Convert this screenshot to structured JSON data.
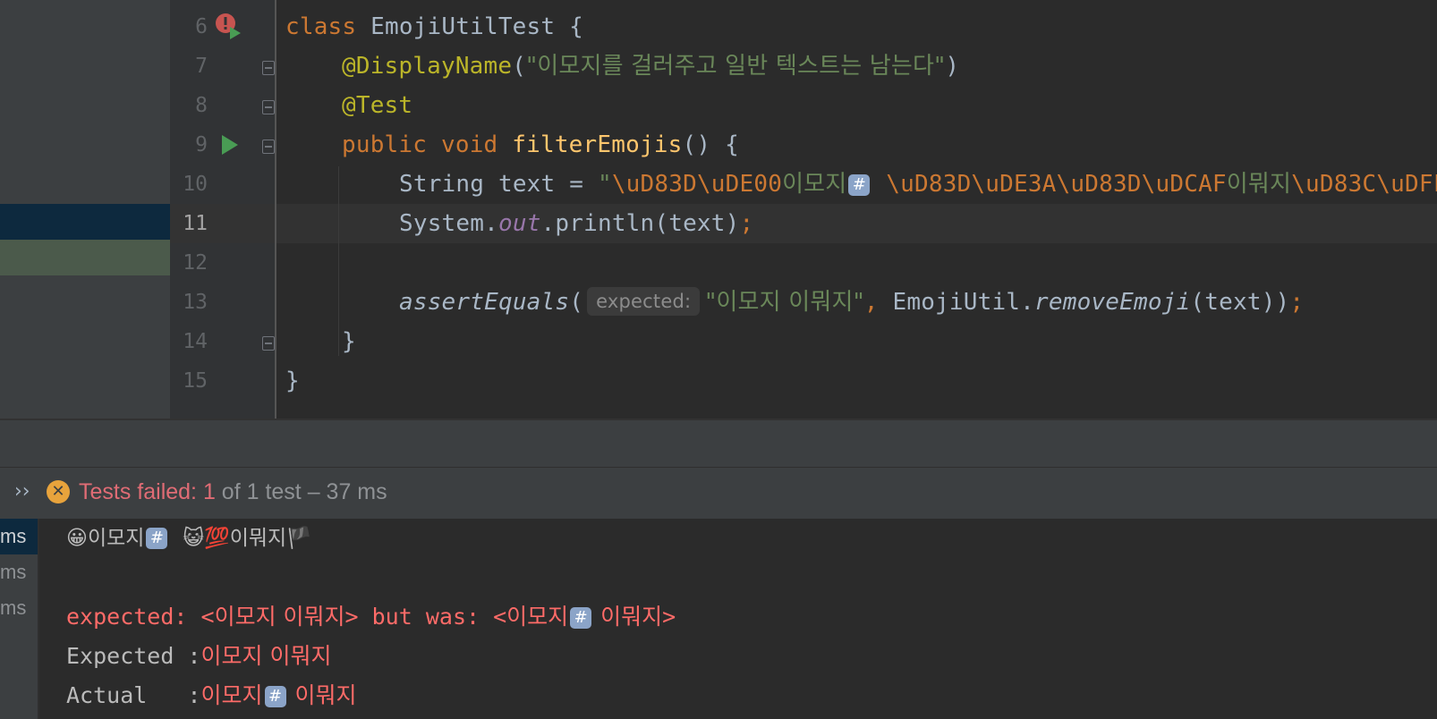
{
  "editor": {
    "line_numbers": [
      "6",
      "7",
      "8",
      "9",
      "10",
      "11",
      "12",
      "13",
      "14",
      "15"
    ],
    "lines": {
      "l6": {
        "kw": "class",
        "name": "EmojiUtilTest",
        "brace": "{"
      },
      "l7": {
        "ann": "@DisplayName",
        "open": "(",
        "str": "\"이모지를 걸러주고 일반 텍스트는 남는다\"",
        "close": ")"
      },
      "l8": {
        "ann": "@Test"
      },
      "l9": {
        "kw1": "public",
        "kw2": "void",
        "fn": "filterEmojis",
        "rest": "() {"
      },
      "l10": {
        "type": "String text = ",
        "q": "\"",
        "esc1": "\\uD83D\\uDE00",
        "str1": "이모지",
        "box": "#",
        "sp": " ",
        "esc2": "\\uD83D\\uDE3A\\uD83D\\uDCAF",
        "str2": "이뭐지",
        "esc3": "\\uD83C\\uDFF"
      },
      "l11": {
        "a": "System.",
        "fld": "out",
        "b": ".println(text)",
        "semi": ";"
      },
      "l13": {
        "fn": "assertEquals",
        "open": "(",
        "hint": "expected:",
        "str": "\"이모지 이뭐지\"",
        "comma": ", ",
        "cls": "EmojiUtil.",
        "m": "removeEmoji",
        "args": "(text))",
        "semi": ";"
      },
      "l14": {
        "brace": "}"
      },
      "l15": {
        "brace": "}"
      }
    }
  },
  "status": {
    "chevron": "››",
    "fail_label": "Tests failed: 1",
    "detail": " of 1 test – 37 ms"
  },
  "side_times": [
    "ms",
    "ms",
    "ms"
  ],
  "console": {
    "output": {
      "e1": "😀",
      "t1": "이모지",
      "box": "#",
      "sp": "  ",
      "e2": "😺💯",
      "t2": "이뭐지",
      "e3": "🏴"
    },
    "assert": {
      "a": "expected: <",
      "b": "이모지 이뭐지",
      "c": "> but was: <",
      "d": "이모지",
      "box": "#",
      "e": " 이뭐지",
      "f": ">"
    },
    "expected": {
      "label": "Expected :",
      "value": "이모지 이뭐지"
    },
    "actual": {
      "label": "Actual   :",
      "v1": "이모지",
      "box": "#",
      "v2": " 이뭐지"
    }
  },
  "colors": {
    "background": "#2b2b2b",
    "keyword": "#cc7832",
    "annotation": "#bbb529",
    "string": "#6a8759",
    "error": "#ff6b68"
  }
}
